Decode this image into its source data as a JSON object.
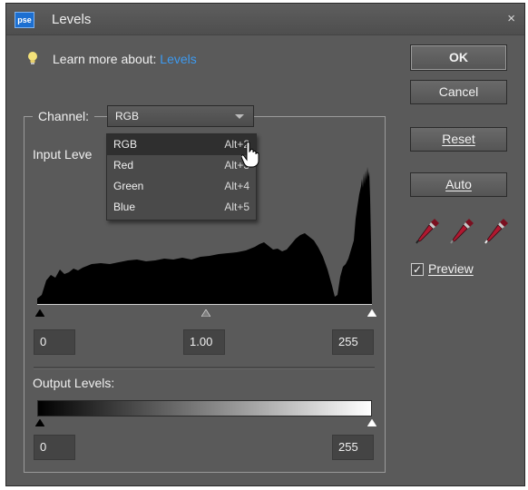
{
  "window": {
    "app_icon": "pse",
    "title": "Levels",
    "close": "×"
  },
  "learn": {
    "prefix": "Learn more about: ",
    "link": "Levels"
  },
  "buttons": {
    "ok": "OK",
    "cancel": "Cancel",
    "reset": "Reset",
    "auto": "Auto"
  },
  "eyedroppers": [
    {
      "name": "black-point-eyedropper-icon"
    },
    {
      "name": "gray-point-eyedropper-icon"
    },
    {
      "name": "white-point-eyedropper-icon"
    }
  ],
  "preview": {
    "label": "Preview",
    "checked": true,
    "check_glyph": "✓"
  },
  "channel": {
    "label": "Channel:",
    "value": "RGB",
    "options": [
      {
        "label": "RGB",
        "shortcut": "Alt+2"
      },
      {
        "label": "Red",
        "shortcut": "Alt+3"
      },
      {
        "label": "Green",
        "shortcut": "Alt+4"
      },
      {
        "label": "Blue",
        "shortcut": "Alt+5"
      }
    ]
  },
  "input_levels": {
    "label": "Input Leve",
    "black": "0",
    "gamma": "1.00",
    "white": "255"
  },
  "output_levels": {
    "label": "Output Levels:",
    "black": "0",
    "white": "255"
  },
  "colors": {
    "dialog_bg": "#5a5a5a",
    "link": "#3d9af0",
    "accent": "#1c6fd1",
    "field_bg": "#444444"
  }
}
